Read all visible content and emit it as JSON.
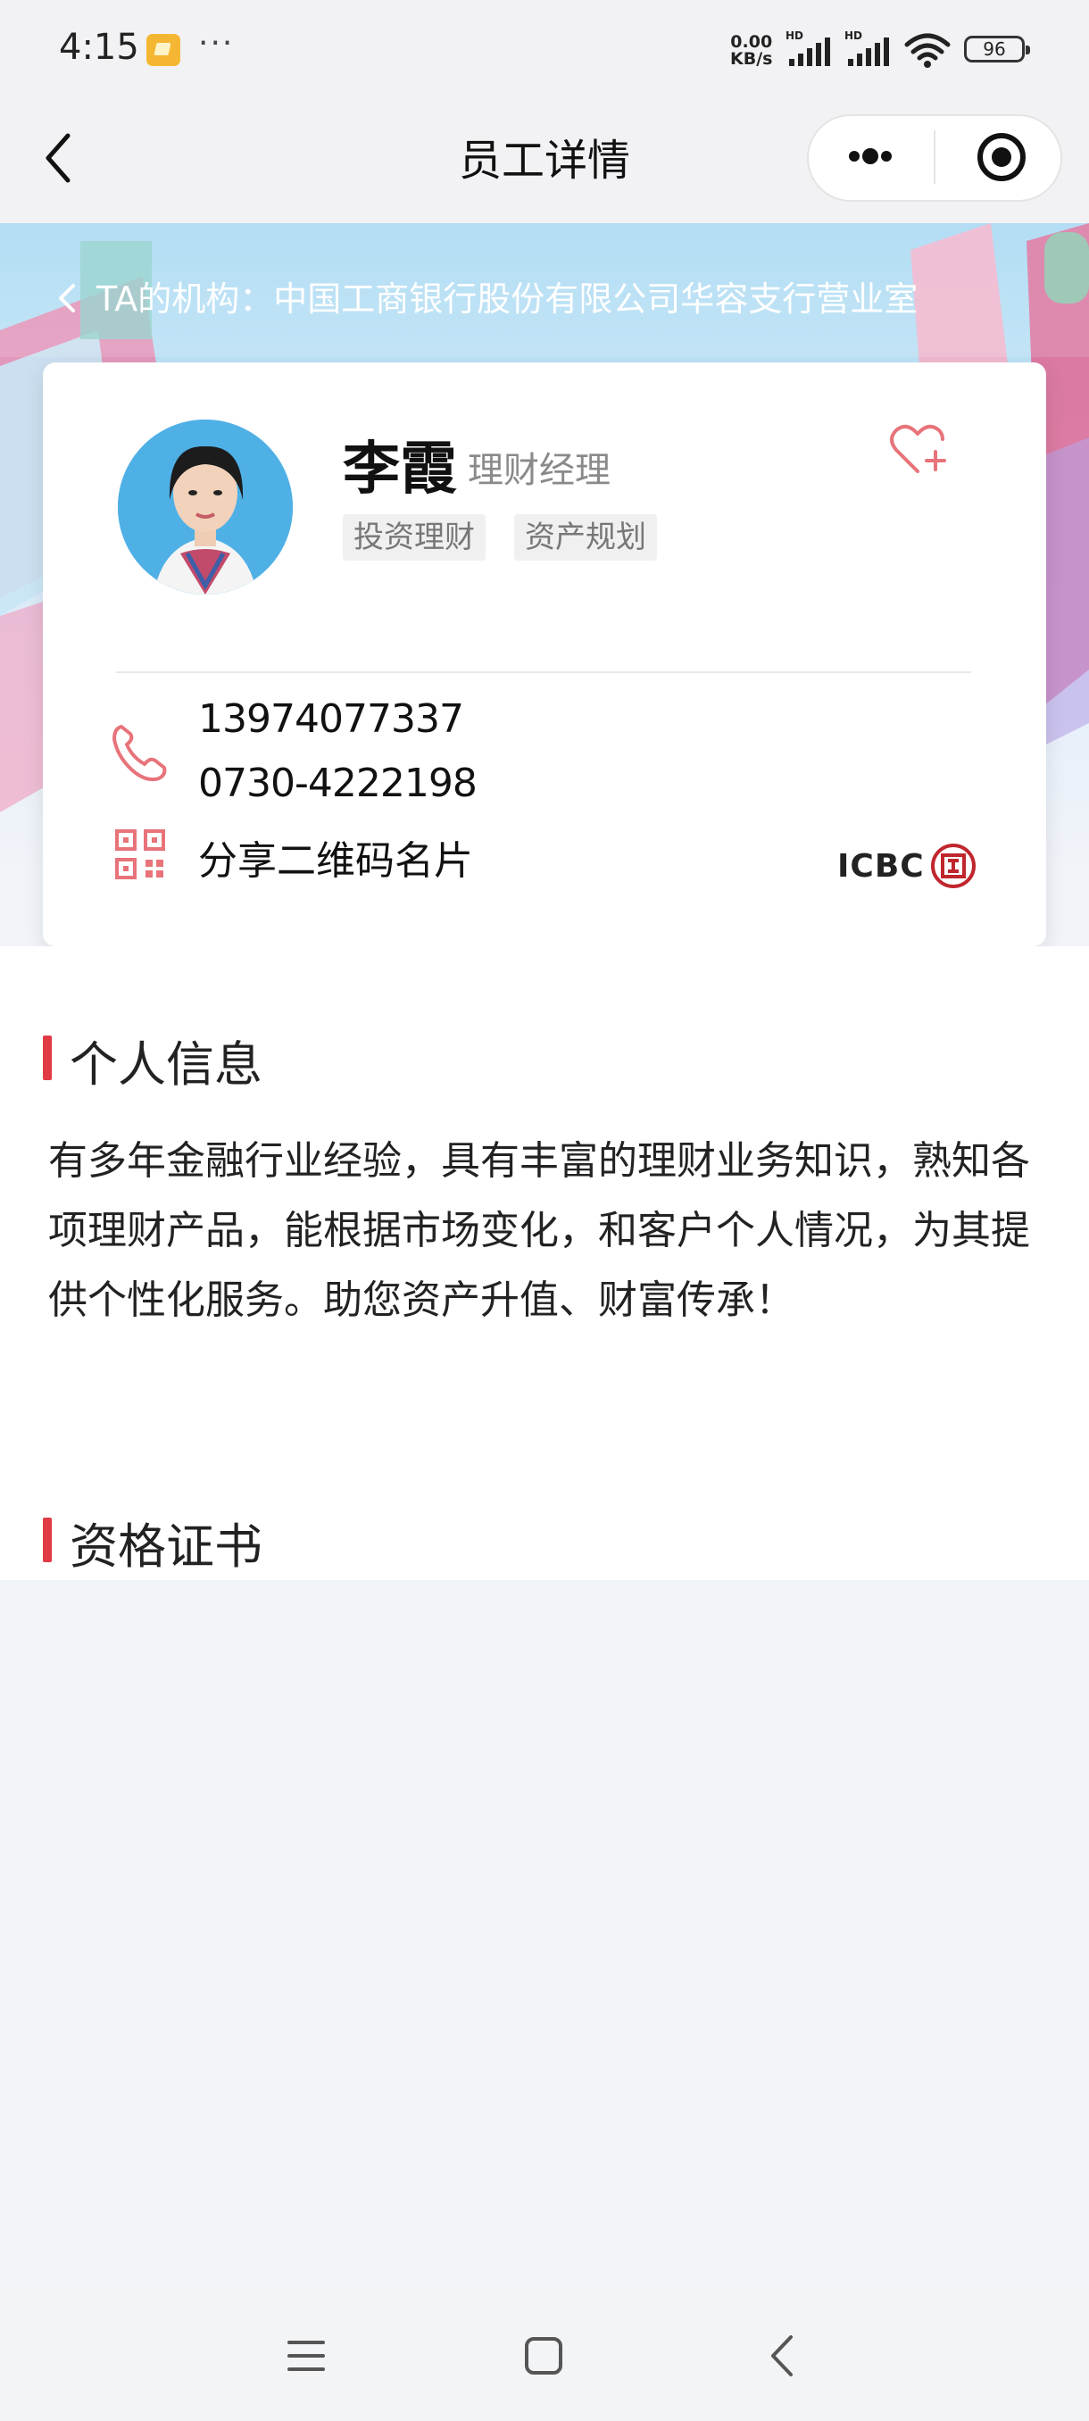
{
  "status_bar": {
    "time": "4:15",
    "more": "···",
    "net_speed_value": "0.00",
    "net_speed_unit": "KB/s",
    "signal_label": "HD",
    "battery": "96"
  },
  "nav": {
    "title": "员工详情"
  },
  "banner": {
    "org_label": "TA的机构：中国工商银行股份有限公司华容支行营业室"
  },
  "profile": {
    "name": "李霞",
    "role": "理财经理",
    "tags": [
      "投资理财",
      "资产规划"
    ],
    "mobile": "13974077337",
    "tel": "0730-4222198",
    "share_qr": "分享二维码名片",
    "bank_brand": "ICBC",
    "bank_logo_char": "工"
  },
  "personal_info": {
    "title": "个人信息",
    "bio": "有多年金融行业经验，具有丰富的理财业务知识，熟知各项理财产品，能根据市场变化，和客户个人情况，为其提供个性化服务。助您资产升值、财富传承！"
  },
  "certificates": {
    "title": "资格证书"
  },
  "colors": {
    "accent_red": "#e03a44",
    "icon_red": "#e8737a",
    "page_bg": "#f1f4f9"
  },
  "icons": {
    "back": "chevron-left-icon",
    "capsule_more": "more-dots-icon",
    "capsule_close": "target-icon",
    "favorite": "heart-plus-icon",
    "phone": "phone-icon",
    "qr": "qr-code-icon",
    "sys_menu": "menu-icon",
    "sys_home": "home-square-icon",
    "sys_back": "back-triangle-icon"
  }
}
